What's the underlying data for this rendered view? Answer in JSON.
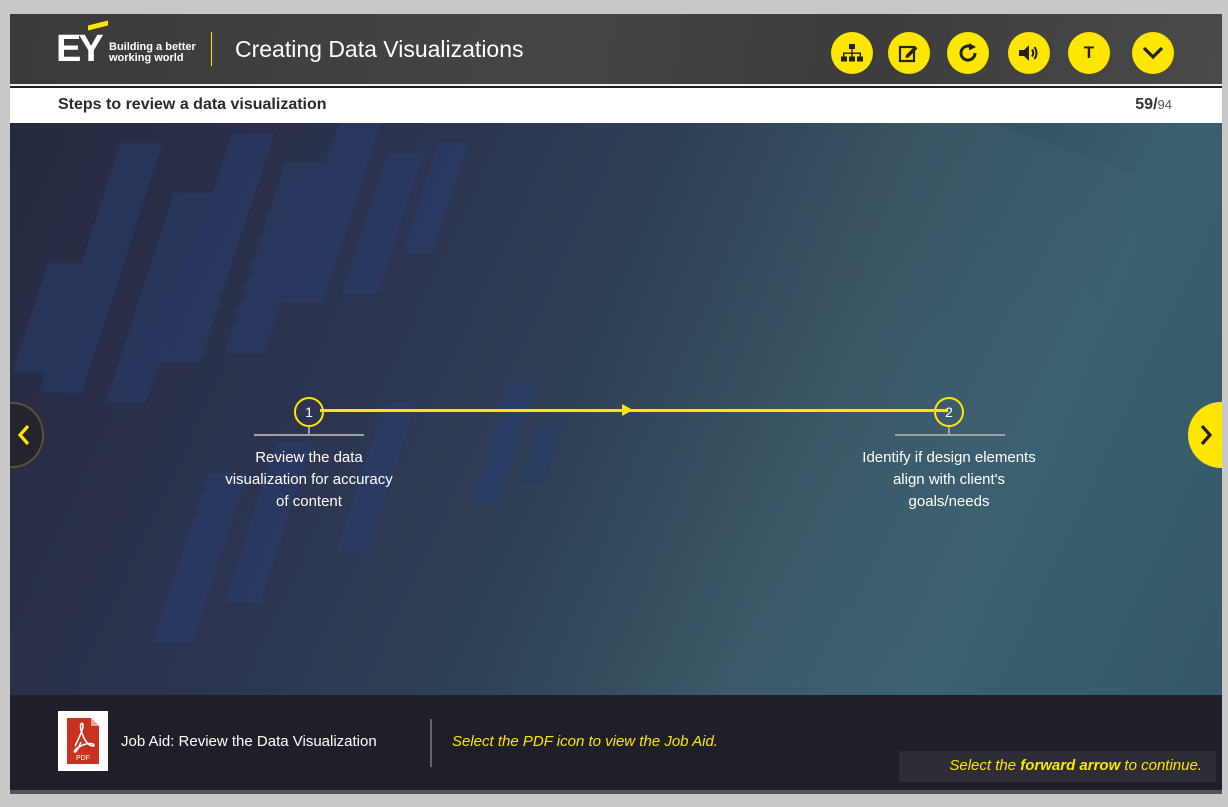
{
  "header": {
    "logo_text": "EY",
    "logo_tagline_1": "Building a better",
    "logo_tagline_2": "working world",
    "course_title": "Creating Data Visualizations",
    "toolbar": [
      {
        "name": "menu-sitemap",
        "icon": "sitemap-icon"
      },
      {
        "name": "notes",
        "icon": "edit-note-icon"
      },
      {
        "name": "replay",
        "icon": "replay-icon"
      },
      {
        "name": "audio",
        "icon": "speaker-icon"
      },
      {
        "name": "transcript",
        "icon": "transcript-icon",
        "label": "T"
      },
      {
        "name": "more",
        "icon": "chevron-down-icon"
      }
    ],
    "accent_color": "#ffe600"
  },
  "subheader": {
    "slide_title": "Steps to review a data visualization",
    "page_current": "59",
    "page_separator": "/",
    "page_total": "94"
  },
  "steps": [
    {
      "number": "1",
      "text": "Review the data visualization for accuracy of content"
    },
    {
      "number": "2",
      "text": "Identify if design elements align with client's goals/needs"
    }
  ],
  "navigation": {
    "prev_icon": "chevron-left-icon",
    "next_icon": "chevron-right-icon"
  },
  "footer": {
    "pdf_icon_label": "PDF",
    "job_aid_label": "Job Aid: Review the Data Visualization",
    "hint": "Select the PDF icon to view the Job Aid.",
    "continue_prefix": "Select the ",
    "continue_bold": "forward arrow",
    "continue_suffix": " to continue."
  }
}
